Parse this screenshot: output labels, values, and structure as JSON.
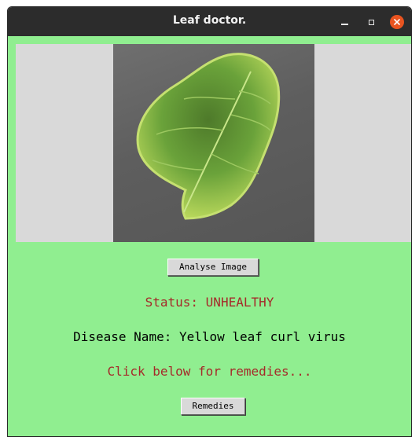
{
  "window": {
    "title": "Leaf doctor."
  },
  "controls": {
    "minimize_icon": "minimize-icon",
    "maximize_icon": "maximize-icon",
    "close_icon": "close-icon",
    "close_color": "#e95420"
  },
  "content": {
    "background": "#90ee90",
    "analyse_button_label": "Analyse Image",
    "status_text": "Status: UNHEALTHY",
    "disease_text": "Disease Name: Yellow leaf curl virus",
    "remedies_prompt": "Click below for remedies...",
    "remedies_button_label": "Remedies",
    "status_color": "#a52a2a"
  }
}
